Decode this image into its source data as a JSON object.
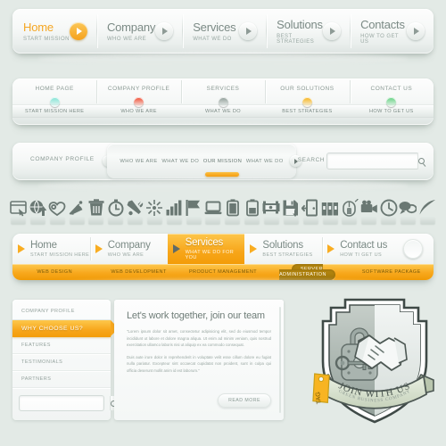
{
  "theme": {
    "background": "#e3eae6",
    "accent": "#f5a623",
    "accent_dark": "#f09a05",
    "text_muted": "#8b9a94"
  },
  "bar1": {
    "items": [
      {
        "title": "Home",
        "sub": "START MISSION",
        "icon": "play-icon",
        "active": true
      },
      {
        "title": "Company",
        "sub": "WHO WE ARE",
        "icon": "play-icon",
        "active": false
      },
      {
        "title": "Services",
        "sub": "WHAT WE DO",
        "icon": "play-icon",
        "active": false
      },
      {
        "title": "Solutions",
        "sub": "BEST STRATEGIES",
        "icon": "play-icon",
        "active": false
      },
      {
        "title": "Contacts",
        "sub": "HOW TO GET US",
        "icon": "play-icon",
        "active": false
      }
    ]
  },
  "bar2": {
    "items": [
      {
        "title": "HOME PAGE",
        "sub": "START MISSION HERE",
        "dot": "#7fe3d4"
      },
      {
        "title": "COMPANY PROFILE",
        "sub": "WHO WE ARE",
        "dot": "#f0472c"
      },
      {
        "title": "SERVICES",
        "sub": "WHAT WE DO",
        "dot": "#8b9a94"
      },
      {
        "title": "OUR SOLUTIONS",
        "sub": "BEST STRATEGIES",
        "dot": "#f7b113"
      },
      {
        "title": "CONTACT US",
        "sub": "HOW TO GET US",
        "dot": "#5fd07e"
      }
    ]
  },
  "bar3": {
    "brand": "COMPANY PROFILE",
    "prev_icon": "chevron-left-icon",
    "next_icon": "chevron-right-icon",
    "tabs": [
      {
        "label": "WHO WE ARE",
        "selected": false
      },
      {
        "label": "WHAT WE DO",
        "selected": false
      },
      {
        "label": "OUR MISSION",
        "selected": true
      },
      {
        "label": "WHAT WE DO",
        "selected": false
      }
    ],
    "search_label": "SEARCH",
    "search_value": "",
    "search_placeholder": "",
    "search_icon": "search-icon"
  },
  "icon_row": {
    "icons": [
      "browser-window-icon",
      "globe-upload-icon",
      "heart-favorite-icon",
      "satellite-dish-icon",
      "trash-icon",
      "stopwatch-icon",
      "tools-icon",
      "compass-icon",
      "bar-chart-icon",
      "flag-icon",
      "laptop-icon",
      "battery-full-icon",
      "battery-half-icon",
      "film-reel-icon",
      "floppy-save-icon",
      "exit-door-icon",
      "binders-icon",
      "mouse-icon",
      "video-camera-icon",
      "clock-icon",
      "speech-bubbles-icon",
      "feather-icon"
    ]
  },
  "bar4": {
    "items": [
      {
        "title": "Home",
        "sub": "START MISSION HERE",
        "icon": "triangle-icon",
        "active": false
      },
      {
        "title": "Company",
        "sub": "WHO WE ARE",
        "icon": "triangle-icon",
        "active": false
      },
      {
        "title": "Services",
        "sub": "WHAT WE DO FOR YOU",
        "icon": "triangle-icon",
        "active": true
      },
      {
        "title": "Solutions",
        "sub": "BEST STRATEGIES",
        "icon": "triangle-icon",
        "active": false
      },
      {
        "title": "Contact us",
        "sub": "HOW TI GET US",
        "icon": "triangle-icon",
        "active": false
      }
    ],
    "round_button": "circle-button",
    "submenu": [
      {
        "label": "WEB DESIGN",
        "selected": false
      },
      {
        "label": "WEB DEVELOPMENT",
        "selected": false
      },
      {
        "label": "PRODUCT MANAGEMENT",
        "selected": false
      },
      {
        "label": "SERVER ADMINISTRATION",
        "selected": true
      },
      {
        "label": "SOFTWARE PACKAGE",
        "selected": false
      }
    ]
  },
  "sidebar": {
    "items": [
      {
        "label": "COMPANY PROFILE",
        "active": false
      },
      {
        "label": "WHY CHOOSE US?",
        "active": true
      },
      {
        "label": "FEATURES",
        "active": false
      },
      {
        "label": "TESTIMONIALS",
        "active": false
      },
      {
        "label": "PARTNERS",
        "active": false
      }
    ],
    "search_value": "",
    "search_placeholder": "",
    "search_icon": "search-icon"
  },
  "content": {
    "heading": "Let's work together, join our team",
    "paragraph1": "\"Lorem ipsum dolor sit amet, consectetur adipisicing elit, sed do eiusmod tempor incididunt ut labore et dolore magna aliqua. Ut enim ad minim veniam, quis nostrud exercitation ullamco laboris nisi ut aliquip ex ea commodo consequat.",
    "paragraph2": "Duis aute irure dolor in reprehenderit in voluptate velit esse cillum dolore eu fugiat nulla pariatur. Excepteur sint occaecat cupidatat non proident, sunt in culpa qui officia deserunt mollit anim id est laborum.\"",
    "read_more": "READ MORE"
  },
  "badge": {
    "ribbon_title": "JOIN WITH US",
    "ribbon_subtitle": "GREEN BUSINESS COMPANY",
    "tag_label": "TAG",
    "emblem": "shield-handshake-lock-emblem"
  }
}
